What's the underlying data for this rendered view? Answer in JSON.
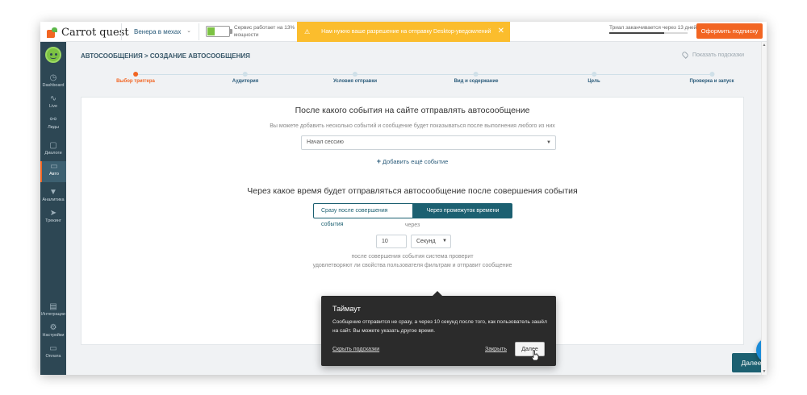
{
  "topbar": {
    "logo_text": "Carrot quest",
    "project": "Венера в мехах",
    "service_status": "Сервис работает на 13% мощности",
    "notice": "Нам нужно ваше разрешение на отправку Desktop-уведомлений",
    "trial": "Триал заканчивается через 13 дней",
    "trial_progress": 0.7,
    "subscribe_label": "Оформить подписку",
    "battery_level": 0.35,
    "colors": {
      "accent": "#f26522",
      "notice": "#fbbd2d",
      "primary": "#1c6071"
    }
  },
  "sidebar": {
    "items": [
      {
        "label": "Dashboard",
        "icon": "dashboard-icon"
      },
      {
        "label": "Live",
        "icon": "live-icon"
      },
      {
        "label": "Лиды",
        "icon": "users-icon"
      },
      {
        "label": "Диалоги",
        "icon": "chat-icon"
      },
      {
        "label": "Авто",
        "icon": "monitor-icon"
      },
      {
        "label": "Аналитика",
        "icon": "funnel-icon"
      },
      {
        "label": "Трекинг",
        "icon": "pointer-icon"
      },
      {
        "label": "Интеграции",
        "icon": "puzzle-icon"
      },
      {
        "label": "Настройки",
        "icon": "gear-icon"
      },
      {
        "label": "Оплата",
        "icon": "card-icon"
      }
    ]
  },
  "header": {
    "breadcrumb_root": "АВТОСООБЩЕНИЯ",
    "breadcrumb_sep": " > ",
    "breadcrumb_current": "СОЗДАНИЕ АВТОСООБЩЕНИЯ",
    "hints_label": "Показать подсказки"
  },
  "steps": [
    {
      "label": "Выбор триггера"
    },
    {
      "label": "Аудитория"
    },
    {
      "label": "Условия отправки"
    },
    {
      "label": "Вид и содержание"
    },
    {
      "label": "Цель"
    },
    {
      "label": "Проверка и запуск"
    }
  ],
  "form": {
    "event_title": "После какого события на сайте отправлять автосообщение",
    "event_hint": "Вы можете добавить несколько событий и сообщение будет показываться после выполнения любого из них",
    "event_select": "Начал сессию",
    "add_event": "Добавить ещё событие",
    "time_title": "Через какое время будет отправляться автосообщение после совершения события",
    "option_immediate": "Сразу после совершения события",
    "option_delay": "Через промежуток времени",
    "after_label": "через",
    "delay_value": "10",
    "delay_unit": "Секунд",
    "check_line1": "после совершения события система проверит",
    "check_line2": "удовлетворяют ли свойства пользователя фильтрам и отправит сообщение"
  },
  "popover": {
    "title": "Таймаут",
    "body": "Сообщение отправится не сразу, а через 10 секунд после того, как пользователь зашёл на сайт. Вы можете указать другое время.",
    "hide": "Скрыть подсказки",
    "close": "Закрыть",
    "next": "Далее"
  },
  "footer": {
    "next_label": "Далее"
  }
}
